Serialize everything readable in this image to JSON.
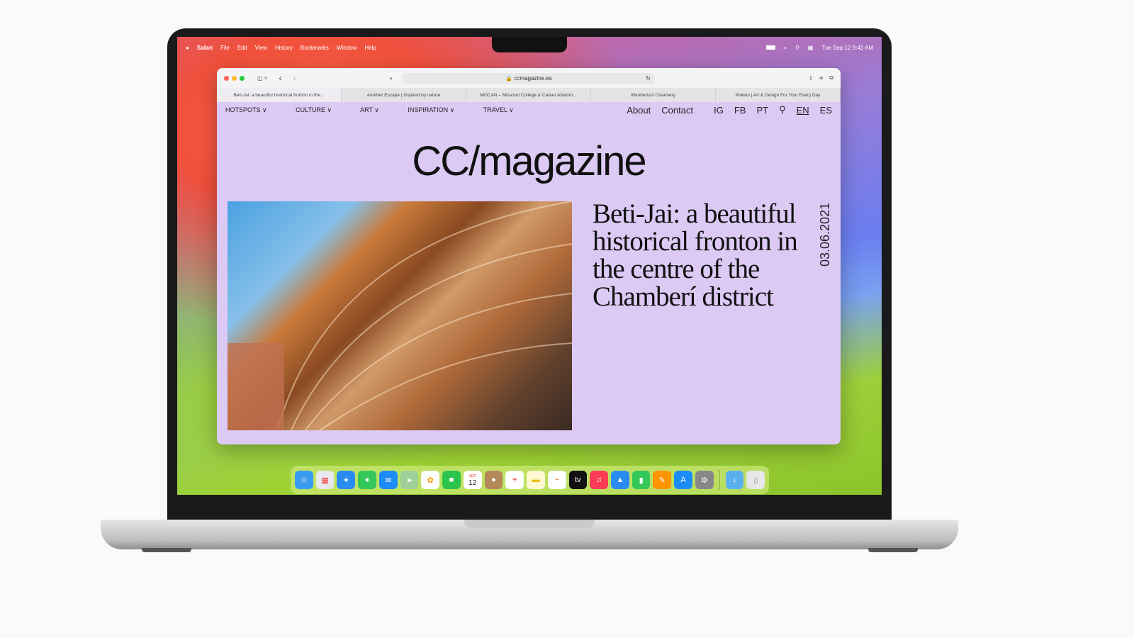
{
  "menubar": {
    "apple": "",
    "app": "Safari",
    "items": [
      "File",
      "Edit",
      "View",
      "History",
      "Bookmarks",
      "Window",
      "Help"
    ],
    "clock": "Tue Sep 12  9:41 AM"
  },
  "browser": {
    "url": "ccmagazine.es",
    "tabs": [
      "Beti-Jai: a beautiful historical fronton in the...",
      "Another Escape | Inspired by nature",
      "MOCAN – Missouri College & Career Attainm...",
      "Wanderlust Creamery",
      "Poketo | Art & Design For Your Every Day"
    ]
  },
  "site": {
    "nav": [
      "HOTSPOTS ∨",
      "CULTURE ∨",
      "ART ∨",
      "INSPIRATION ∨",
      "TRAVEL ∨"
    ],
    "about": "About",
    "contact": "Contact",
    "social": [
      "IG",
      "FB",
      "PT"
    ],
    "langs": [
      "EN",
      "ES"
    ],
    "logo": "CC/magazine",
    "article": {
      "title": "Beti-Jai: a beautiful historical fronton in the centre of the Chamberí district",
      "date": "03.06.2021"
    }
  },
  "dock": {
    "calendar_month": "SEP",
    "calendar_day": "12",
    "apps": [
      "finder",
      "launchpad",
      "safari",
      "messages",
      "mail",
      "maps",
      "photos",
      "facetime",
      "calendar",
      "contacts",
      "reminders",
      "notes",
      "freeform",
      "tv",
      "music",
      "keynote",
      "numbers",
      "pages",
      "app-store",
      "system-settings",
      "downloads",
      "trash"
    ]
  },
  "colors": {
    "page_bg": "#dccaf5"
  }
}
